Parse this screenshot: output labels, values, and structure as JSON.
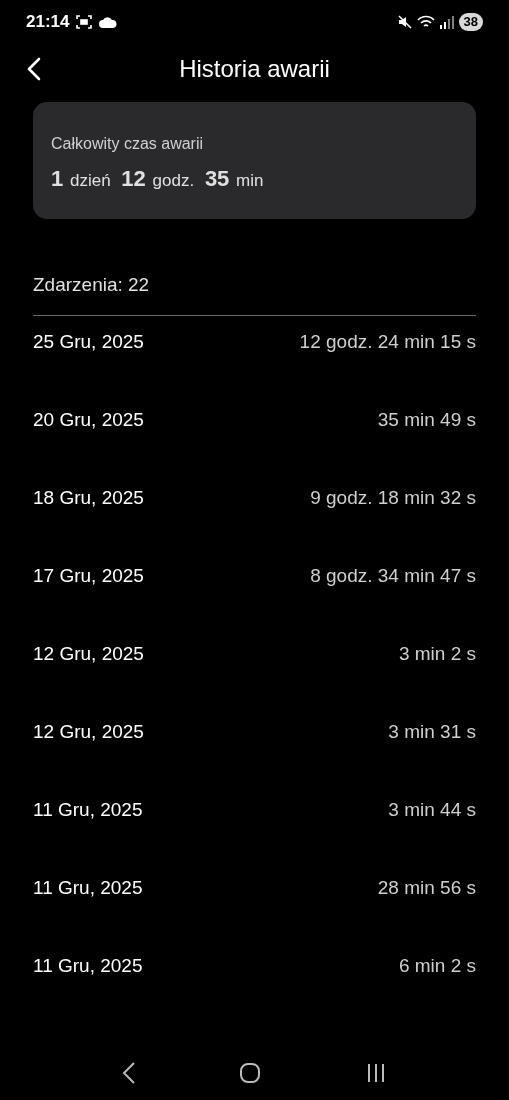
{
  "status_bar": {
    "time": "21:14",
    "battery": "38"
  },
  "header": {
    "title": "Historia awarii"
  },
  "summary": {
    "label": "Całkowity czas awarii",
    "total": [
      {
        "value": "1",
        "unit": "dzień"
      },
      {
        "value": "12",
        "unit": "godz."
      },
      {
        "value": "35",
        "unit": "min"
      }
    ]
  },
  "events_count": "Zdarzenia: 22",
  "events": [
    {
      "date": "25 Gru, 2025",
      "duration": "12 godz. 24 min 15 s"
    },
    {
      "date": "20 Gru, 2025",
      "duration": "35 min 49 s"
    },
    {
      "date": "18 Gru, 2025",
      "duration": "9 godz. 18 min 32 s"
    },
    {
      "date": "17 Gru, 2025",
      "duration": "8 godz. 34 min 47 s"
    },
    {
      "date": "12 Gru, 2025",
      "duration": "3 min 2 s"
    },
    {
      "date": "12 Gru, 2025",
      "duration": "3 min 31 s"
    },
    {
      "date": "11 Gru, 2025",
      "duration": "3 min 44 s"
    },
    {
      "date": "11 Gru, 2025",
      "duration": "28 min 56 s"
    },
    {
      "date": "11 Gru, 2025",
      "duration": "6 min 2 s"
    }
  ]
}
